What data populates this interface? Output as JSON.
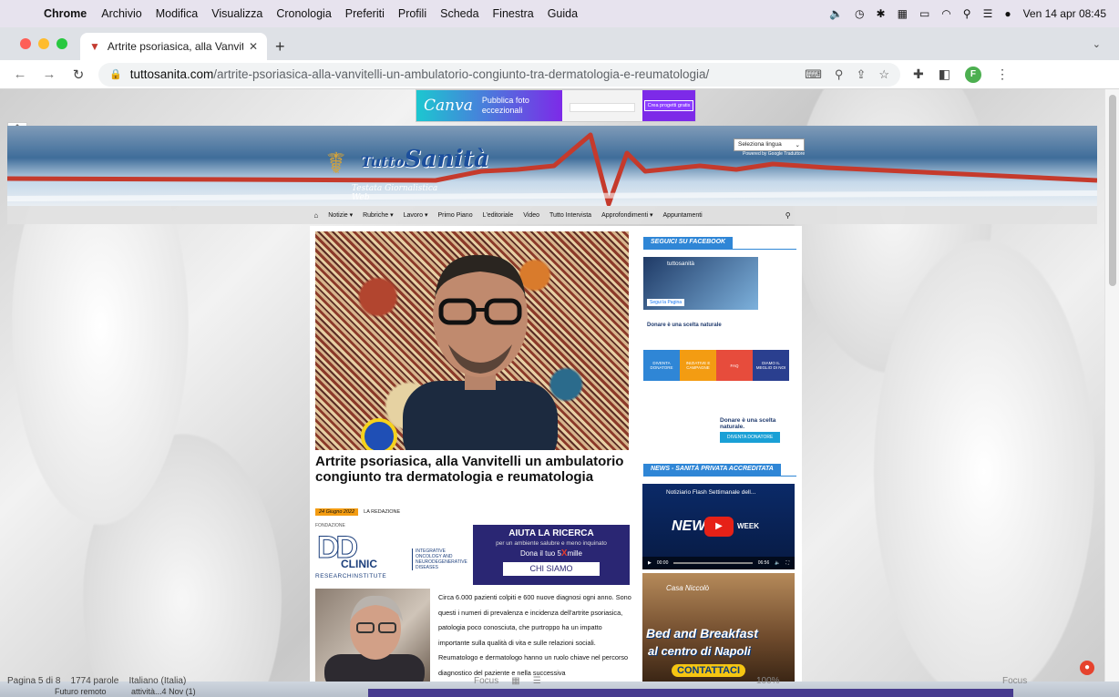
{
  "menubar": {
    "app": "Chrome",
    "items": [
      "Archivio",
      "Modifica",
      "Visualizza",
      "Cronologia",
      "Preferiti",
      "Profili",
      "Scheda",
      "Finestra",
      "Guida"
    ],
    "clock": "Ven 14 apr 08:45"
  },
  "tab": {
    "title": "Artrite psoriasica, alla Vanvitelli"
  },
  "address": {
    "host": "tuttosanita.com",
    "path": "/artrite-psoriasica-alla-vanvitelli-un-ambulatorio-congiunto-tra-dermatologia-e-reumatologia/"
  },
  "profile": {
    "initial": "F"
  },
  "ad_canva": {
    "logo": "Canva",
    "tagline_1": "Pubblica foto",
    "tagline_2": "eccezionali",
    "cta": "Crea progetti gratis"
  },
  "site": {
    "brand": "Sanità",
    "brand_prefix": "Tutto",
    "subtitle": "Testata Giornalistica Web",
    "language_select": "Seleziona lingua",
    "translator": "Powered by Google Traduttore",
    "nav": [
      "Notizie ▾",
      "Rubriche ▾",
      "Lavoro ▾",
      "Primo Piano",
      "L'editoriale",
      "Video",
      "Tutto Intervista",
      "Approfondimenti ▾",
      "Appuntamenti"
    ]
  },
  "article": {
    "title": "Artrite psoriasica, alla Vanvitelli un ambulatorio congiunto tra dermatologia e reumatologia",
    "date": "24 Giugno 2022",
    "author": "LA REDAZIONE",
    "body": "Circa 6.000 pazienti colpiti e 600 nuove diagnosi ogni anno. Sono questi i numeri di prevalenza e incidenza dell'artrite psoriasica, patologia poco conosciuta, che purtroppo ha un impatto importante sulla qualità di vita e sulle relazioni sociali. Reumatologo e dermatologo hanno un ruolo chiave nel percorso diagnostico del paziente e nella successiva"
  },
  "clinic_ad": {
    "foundation": "FONDAZIONE",
    "name": "CLINIC",
    "research": "RESEARCHINSTITUTE",
    "side_1": "INTEGRATIVE",
    "side_2": "ONCOLOGY AND",
    "side_3": "NEURODEGENERATIVE",
    "side_4": "DISEASES"
  },
  "help_ad": {
    "title": "AIUTA LA RICERCA",
    "subtitle": "per un ambiente salubre e meno inquinato",
    "donate_pre": "Dona il tuo 5",
    "donate_x": "X",
    "donate_post": "mille",
    "cta": "CHI SIAMO"
  },
  "sidebar": {
    "facebook_label": "SEGUICI SU FACEBOOK",
    "fb_page_name": "tuttosanità",
    "fb_follow": "Segui la Pagina",
    "donor_top": "Donare è una scelta naturale",
    "donor_tabs": [
      "DIVENTA DONATORE",
      "INIZIATIVE E CAMPAGNE",
      "FAQ",
      "DIAMO IL MEGLIO DI NOI"
    ],
    "donor_mid": "Donare è una scelta naturale.",
    "donor_cta": "DIVENTA DONATORE",
    "news_label": "NEWS - SANITÀ PRIVATA ACCREDITATA",
    "video_title": "Notiziario Flash Settimanale dell...",
    "video_news": "NEW",
    "video_week": "WEEK",
    "video_time_start": "00:00",
    "video_time_end": "06:56",
    "bnb_house": "Casa Niccolò",
    "bnb_line1": "Bed and Breakfast",
    "bnb_line2": "al centro di Napoli",
    "bnb_cta": "CONTATTACI"
  },
  "statusbar": {
    "page": "Pagina 5 di 8",
    "words": "1774 parole",
    "lang": "Italiano (Italia)",
    "line2": "Futuro remoto",
    "line2b": "attività...4 Nov (1)",
    "focus": "Focus",
    "zoom": "100%"
  }
}
